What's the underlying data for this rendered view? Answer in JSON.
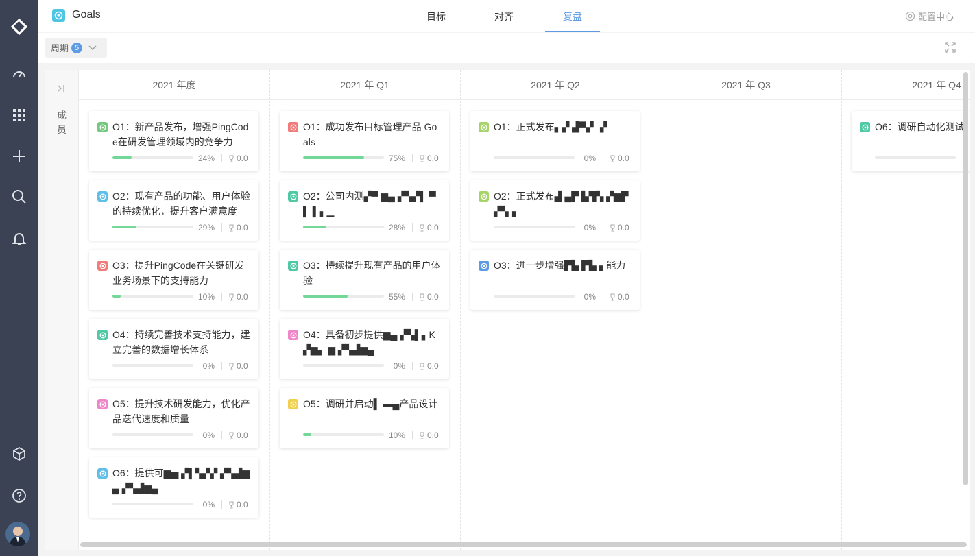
{
  "app": {
    "title": "Goals"
  },
  "tabs": [
    {
      "label": "目标",
      "active": false
    },
    {
      "label": "对齐",
      "active": false
    },
    {
      "label": "复盘",
      "active": true
    }
  ],
  "config": {
    "label": "配置中心"
  },
  "filter": {
    "period_label": "周期",
    "period_count": "5"
  },
  "member_label": "成员",
  "columns": [
    "2021 年度",
    "2021 年 Q1",
    "2021 年 Q2",
    "2021 年 Q3",
    "2021 年 Q4"
  ],
  "cards": [
    {
      "column": 0,
      "title": "O1：新产品发布，增强PingCode在研发管理领域内的竞争力",
      "progress": 24,
      "progress_text": "24%",
      "score": "0.0",
      "icon_color": "#76c87e"
    },
    {
      "column": 0,
      "title": "O2：现有产品的功能、用户体验的持续优化，提升客户满意度",
      "progress": 29,
      "progress_text": "29%",
      "score": "0.0",
      "icon_color": "#5fbfe8"
    },
    {
      "column": 0,
      "title": "O3：提升PingCode在关键研发业务场景下的支持能力",
      "progress": 10,
      "progress_text": "10%",
      "score": "0.0",
      "icon_color": "#ef7b7b"
    },
    {
      "column": 0,
      "title": "O4：持续完善技术支持能力，建立完善的数据增长体系",
      "progress": 0,
      "progress_text": "0%",
      "score": "0.0",
      "icon_color": "#4fc9a4"
    },
    {
      "column": 0,
      "title": "O5：提升技术研发能力，优化产品迭代速度和质量",
      "progress": 0,
      "progress_text": "0%",
      "score": "0.0",
      "icon_color": "#ef86c9"
    },
    {
      "column": 0,
      "title": "O6：提供可▆▅ ▞▌▚▞▞ ▞▚▟▆▄ ▞▚▟▆▄",
      "progress": 0,
      "progress_text": "0%",
      "score": "0.0",
      "icon_color": "#5fbfe8"
    },
    {
      "column": 1,
      "title": "O1：成功发布目标管理产品 Goals",
      "progress": 75,
      "progress_text": "75%",
      "score": "0.0",
      "icon_color": "#ef7b7b"
    },
    {
      "column": 1,
      "title": "O2：公司内测▞▀ ▆▄ ▞▚▞▌ ▀▌ ▌▖▁",
      "progress": 28,
      "progress_text": "28%",
      "score": "0.0",
      "icon_color": "#4fc9a4"
    },
    {
      "column": 1,
      "title": "O3：持续提升现有产品的用户体验",
      "progress": 55,
      "progress_text": "55%",
      "score": "0.0",
      "icon_color": "#4fc9a4"
    },
    {
      "column": 1,
      "title": "O4：具备初步提供▆▄ ▞▚▌▖K ▞▆▖ ▆ ▞▚▟▆▄",
      "progress": 0,
      "progress_text": "0%",
      "score": "0.0",
      "icon_color": "#ef86c9"
    },
    {
      "column": 1,
      "title": "O5：调研并启动▌ ▬▄产品设计",
      "progress": 10,
      "progress_text": "10%",
      "score": "0.0",
      "icon_color": "#f1cf4f"
    },
    {
      "column": 2,
      "title": "O1：正式发布▖▞ ▟▀▞ ▗▘",
      "progress": 0,
      "progress_text": "0%",
      "score": "0.0",
      "icon_color": "#a5d46a"
    },
    {
      "column": 2,
      "title": "O2：正式发布▟ ▄▛ ▙▜▚ ▞▆▛ ▞▚▗",
      "progress": 0,
      "progress_text": "0%",
      "score": "0.0",
      "icon_color": "#a5d46a"
    },
    {
      "column": 2,
      "title": "O3：进一步增强▛▙ ▛▙ ▖能力",
      "progress": 0,
      "progress_text": "0%",
      "score": "0.0",
      "icon_color": "#5d9ce5"
    },
    {
      "column": 4,
      "title": "O6：调研自动化测试",
      "progress": 0,
      "progress_text": "",
      "score": "",
      "icon_color": "#4fc9a4"
    }
  ],
  "colors": {
    "accent": "#5d9ce5",
    "rail": "#3b4254",
    "progress": "#73d897"
  }
}
